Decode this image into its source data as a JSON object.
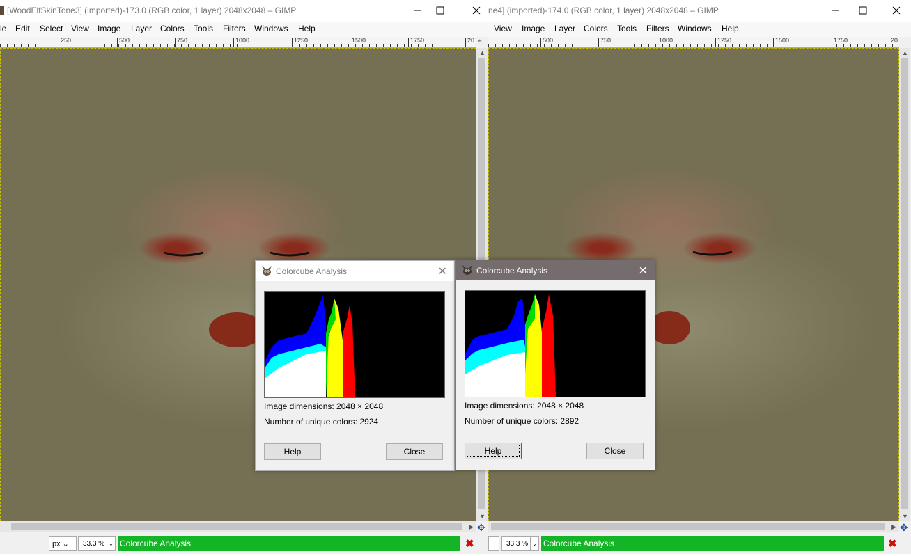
{
  "win1": {
    "title": "[WoodElfSkinTone3] (imported)-173.0 (RGB color, 1 layer) 2048x2048 – GIMP",
    "menu": [
      "le",
      "Edit",
      "Select",
      "View",
      "Image",
      "Layer",
      "Colors",
      "Tools",
      "Filters",
      "Windows",
      "Help"
    ],
    "ruler": [
      "250",
      "500",
      "750",
      "1000",
      "1250",
      "1500",
      "1750",
      "20"
    ],
    "units": "px",
    "zoom": "33.3 %",
    "status": "Colorcube Analysis"
  },
  "win2": {
    "title": "ne4] (imported)-174.0 (RGB color, 1 layer) 2048x2048 – GIMP",
    "menu": [
      "View",
      "Image",
      "Layer",
      "Colors",
      "Tools",
      "Filters",
      "Windows",
      "Help"
    ],
    "ruler": [
      "500",
      "750",
      "1000",
      "1250",
      "1500",
      "1750",
      "20"
    ],
    "zoom": "33.3 %",
    "status": "Colorcube Analysis"
  },
  "dialog1": {
    "title": "Colorcube Analysis",
    "dimensions": "Image dimensions: 2048 × 2048",
    "unique": "Number of unique colors: 2924",
    "help": "Help",
    "close": "Close"
  },
  "dialog2": {
    "title": "Colorcube Analysis",
    "dimensions": "Image dimensions: 2048 × 2048",
    "unique": "Number of unique colors: 2892",
    "help": "Help",
    "close": "Close"
  },
  "colors": {
    "canvas": "#756f54",
    "status_green": "#13b526",
    "dialog_active_title": "#756d6d"
  }
}
